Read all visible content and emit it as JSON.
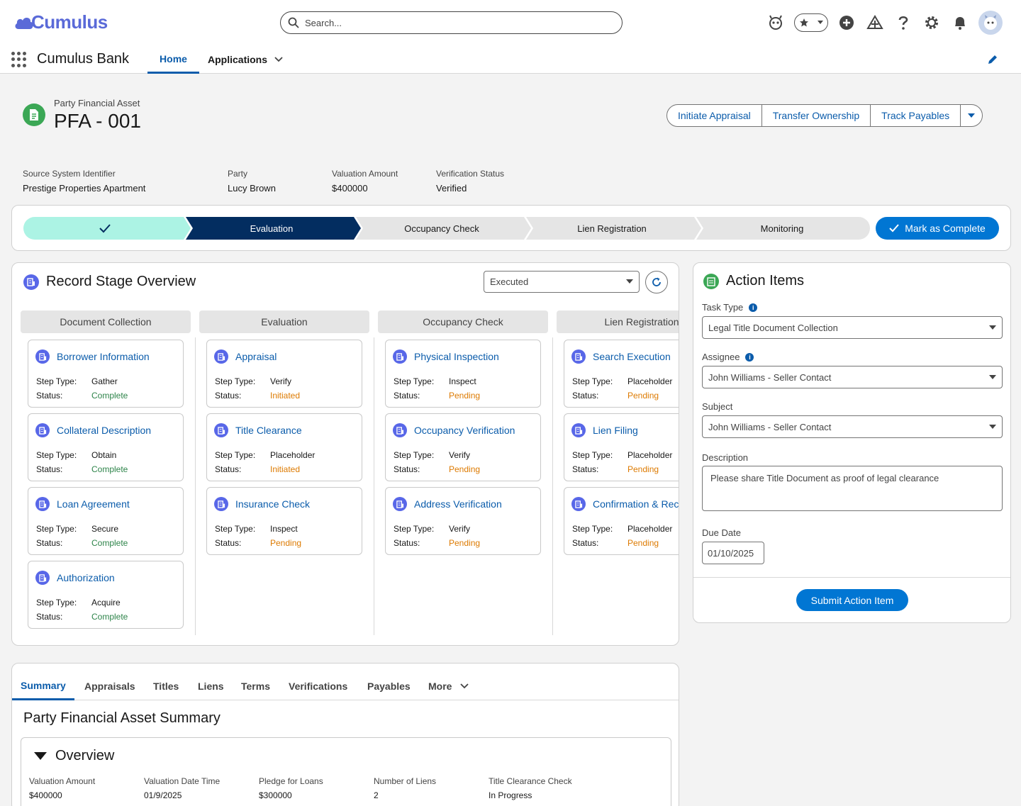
{
  "header": {
    "logo_text": "Cumulus",
    "search_placeholder": "Search..."
  },
  "nav": {
    "app_name": "Cumulus Bank",
    "home": "Home",
    "applications": "Applications"
  },
  "record": {
    "object_type": "Party Financial Asset",
    "title": "PFA - 001",
    "actions": [
      "Initiate Appraisal",
      "Transfer Ownership",
      "Track Payables"
    ],
    "highlights": [
      {
        "label": "Source System Identifier",
        "value": "Prestige Properties Apartment"
      },
      {
        "label": "Party",
        "value": "Lucy Brown"
      },
      {
        "label": "Valuation Amount",
        "value": "$400000"
      },
      {
        "label": "Verification Status",
        "value": "Verified"
      }
    ]
  },
  "path": {
    "stages": [
      "",
      "Evaluation",
      "Occupancy Check",
      "Lien Registration",
      "Monitoring"
    ],
    "complete_stage_index": 0,
    "current_stage_index": 1,
    "mark_complete": "Mark as Complete"
  },
  "stage_overview": {
    "title": "Record Stage Overview",
    "filter": "Executed",
    "step_type_label": "Step Type:",
    "status_label": "Status:",
    "lanes": [
      {
        "name": "Document Collection",
        "steps": [
          {
            "name": "Borrower Information",
            "type": "Gather",
            "status": "Complete"
          },
          {
            "name": "Collateral Description",
            "type": "Obtain",
            "status": "Complete"
          },
          {
            "name": "Loan Agreement",
            "type": "Secure",
            "status": "Complete"
          },
          {
            "name": "Authorization",
            "type": "Acquire",
            "status": "Complete"
          }
        ]
      },
      {
        "name": "Evaluation",
        "steps": [
          {
            "name": "Appraisal",
            "type": "Verify",
            "status": "Initiated"
          },
          {
            "name": "Title Clearance",
            "type": "Placeholder",
            "status": "Initiated"
          },
          {
            "name": "Insurance Check",
            "type": "Inspect",
            "status": "Pending"
          }
        ]
      },
      {
        "name": "Occupancy Check",
        "steps": [
          {
            "name": "Physical Inspection",
            "type": "Inspect",
            "status": "Pending"
          },
          {
            "name": "Occupancy Verification",
            "type": "Verify",
            "status": "Pending"
          },
          {
            "name": "Address Verification",
            "type": "Verify",
            "status": "Pending"
          }
        ]
      },
      {
        "name": "Lien Registration",
        "steps": [
          {
            "name": "Search Execution",
            "type": "Placeholder",
            "status": "Pending"
          },
          {
            "name": "Lien Filing",
            "type": "Placeholder",
            "status": "Pending"
          },
          {
            "name": "Confirmation & Record",
            "type": "Placeholder",
            "status": "Pending"
          }
        ]
      }
    ]
  },
  "action_items": {
    "title": "Action Items",
    "task_type_label": "Task Type",
    "task_type_value": "Legal Title Document Collection",
    "assignee_label": "Assignee",
    "assignee_value": "John Williams - Seller Contact",
    "subject_label": "Subject",
    "subject_value": "John Williams - Seller Contact",
    "description_label": "Description",
    "description_value": "Please share Title Document as proof of legal clearance",
    "due_date_label": "Due Date",
    "due_date_value": "01/10/2025",
    "submit": "Submit Action Item"
  },
  "summary": {
    "tabs": [
      "Summary",
      "Appraisals",
      "Titles",
      "Liens",
      "Terms",
      "Verifications",
      "Payables",
      "More"
    ],
    "active_tab": 0,
    "title": "Party Financial Asset Summary",
    "section": "Overview",
    "fields": [
      {
        "label": "Valuation Amount",
        "value": "$400000"
      },
      {
        "label": "Valuation Date Time",
        "value": "01/9/2025"
      },
      {
        "label": "Pledge for Loans",
        "value": "$300000"
      },
      {
        "label": "Number of Liens",
        "value": "2"
      },
      {
        "label": "Title Clearance Check",
        "value": "In Progress"
      }
    ]
  },
  "colors": {
    "brand": "#0176d3",
    "link": "#0b5cab",
    "complete_stage": "#acf3e4",
    "current_stage": "#032d60",
    "incomplete_stage": "#e5e5e5",
    "status_complete": "#2e844a",
    "status_pending": "#dd7a01"
  }
}
